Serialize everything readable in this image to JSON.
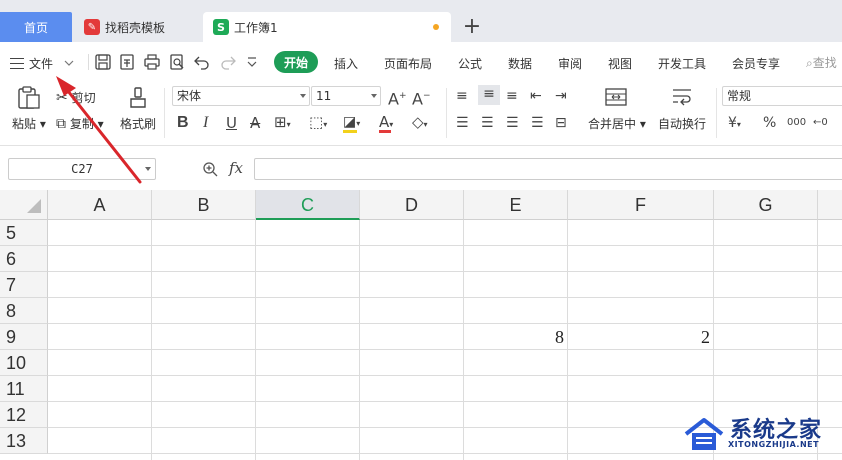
{
  "tabs": {
    "home": "首页",
    "template": "找稻壳模板",
    "sheet": "工作簿1",
    "sheet_icon_letter": "S",
    "add": "+"
  },
  "menu": {
    "file": "文件",
    "start": "开始",
    "items": [
      "插入",
      "页面布局",
      "公式",
      "数据",
      "审阅",
      "视图",
      "开发工具",
      "会员专享"
    ],
    "search": "查找"
  },
  "ribbon": {
    "paste": "粘贴",
    "cut": "剪切",
    "copy": "复制",
    "format_painter": "格式刷",
    "font_name": "宋体",
    "font_size": "11",
    "merge_center": "合并居中",
    "auto_wrap": "自动换行",
    "number_format": "常规",
    "currency_symbol": "¥",
    "percent_symbol": "%",
    "thousands_symbol": "000",
    "decimal_symbol": "←0"
  },
  "formula_bar": {
    "name_box": "C27",
    "fx": "fx",
    "value": ""
  },
  "grid": {
    "columns": [
      "A",
      "B",
      "C",
      "D",
      "E",
      "F",
      "G"
    ],
    "selected_column": "C",
    "rows": [
      "5",
      "6",
      "7",
      "8",
      "9",
      "10",
      "11",
      "12",
      "13"
    ],
    "cells": [
      {
        "ref": "E9",
        "value": "8"
      },
      {
        "ref": "F9",
        "value": "2"
      }
    ]
  },
  "watermark": {
    "title": "系统之家",
    "subtitle": "XITONGZHIJIA.NET"
  },
  "colors": {
    "accent_green": "#1e9d57",
    "home_tab_blue": "#5b8def",
    "arrow_red": "#d9262b"
  }
}
